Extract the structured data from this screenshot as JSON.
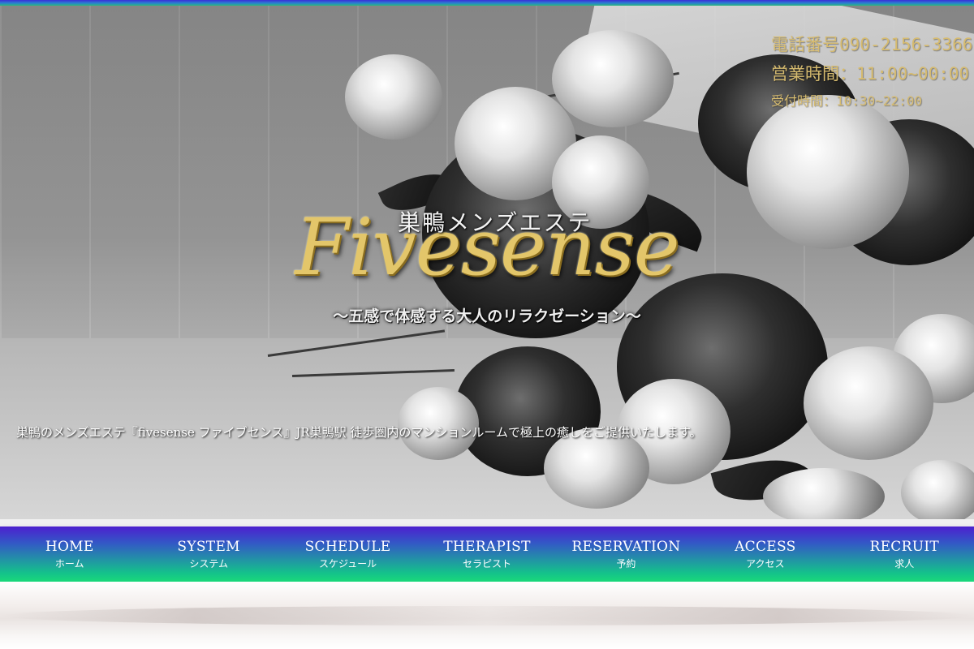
{
  "header": {
    "phone": "電話番号090-2156-3366",
    "hours": "営業時間：11:00~00:00",
    "hours_sub": "受付時間：10:30~22:00"
  },
  "logo": {
    "area": "巣鴨メンズエステ",
    "brand": "Fivesense",
    "tagline": "～五感で体感する大人のリラクゼーション～"
  },
  "hero": {
    "description": "巣鴨のメンズエステ『fivesense ファイブセンス』JR巣鴨駅 徒歩圏内のマンションルームで極上の癒しをご提供いたします。"
  },
  "nav": {
    "items": [
      {
        "en": "HOME",
        "jp": "ホーム"
      },
      {
        "en": "SYSTEM",
        "jp": "システム"
      },
      {
        "en": "SCHEDULE",
        "jp": "スケジュール"
      },
      {
        "en": "THERAPIST",
        "jp": "セラピスト"
      },
      {
        "en": "RESERVATION",
        "jp": "予約"
      },
      {
        "en": "ACCESS",
        "jp": "アクセス"
      },
      {
        "en": "RECRUIT",
        "jp": "求人"
      }
    ]
  },
  "colors": {
    "accent_gold": "#d6bb6f",
    "nav_top": "#4d20cf",
    "nav_bottom": "#1ad87a"
  }
}
